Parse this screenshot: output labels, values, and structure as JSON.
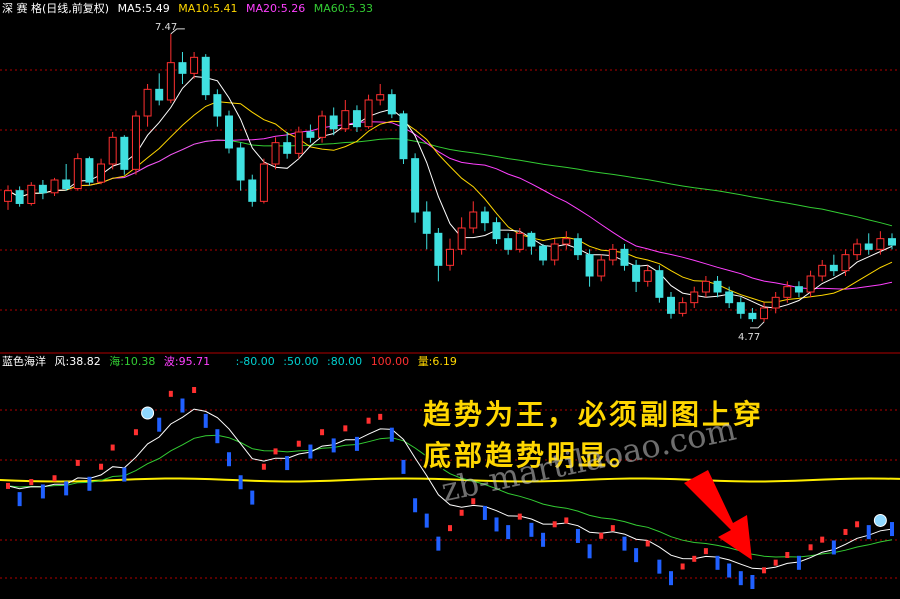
{
  "main_header": {
    "title": "深 赛 格(日线,前复权)",
    "items": [
      {
        "text": "MA5:5.49",
        "color": "#FFFFFF"
      },
      {
        "text": "MA10:5.41",
        "color": "#FFD700"
      },
      {
        "text": "MA20:5.26",
        "color": "#FF40FF"
      },
      {
        "text": "MA60:5.33",
        "color": "#33CC33"
      }
    ]
  },
  "sub_header": {
    "items": [
      {
        "text": "蓝色海洋",
        "color": "#FFFFFF"
      },
      {
        "text": "风:38.82",
        "color": "#FFFFFF"
      },
      {
        "text": "海:10.38",
        "color": "#33CC33"
      },
      {
        "text": "波:95.71",
        "color": "#FF40FF"
      },
      {
        "text": ":-80.00",
        "color": "#00D0D0"
      },
      {
        "text": ":50.00",
        "color": "#00D0D0"
      },
      {
        "text": ":80.00",
        "color": "#00D0D0"
      },
      {
        "text": "100.00",
        "color": "#FF3030"
      },
      {
        "text": "量:6.19",
        "color": "#FFD700"
      }
    ]
  },
  "peak_label": "7.47",
  "trough_label": "4.77",
  "annotation": {
    "line1": "趋势为王，必须副图上穿",
    "line2": "底部趋势明显。"
  },
  "watermark": "zb-martilaoao.com",
  "colors": {
    "up": "#FF3030",
    "down": "#40E0E0",
    "ma60": "#33CC33",
    "ma20": "#FF40FF",
    "ma10": "#FFD700",
    "ma5": "#FFFFFF",
    "dash": "#B00000",
    "arrow": "#FF0000"
  },
  "chart_data": [
    {
      "type": "candlestick",
      "title": "深 赛 格(日线,前复权)",
      "ylim": [
        4.6,
        7.6
      ],
      "annotations": [
        {
          "label": "7.47",
          "value": 7.47
        },
        {
          "label": "4.77",
          "value": 4.77
        }
      ],
      "series": [
        {
          "name": "MA5",
          "last": 5.49
        },
        {
          "name": "MA10",
          "last": 5.41
        },
        {
          "name": "MA20",
          "last": 5.26
        },
        {
          "name": "MA60",
          "last": 5.33
        }
      ],
      "candles": [
        [
          5.9,
          6.0,
          5.82,
          6.05
        ],
        [
          6.0,
          5.88,
          5.85,
          6.04
        ],
        [
          5.88,
          6.05,
          5.86,
          6.08
        ],
        [
          6.05,
          5.98,
          5.92,
          6.1
        ],
        [
          5.98,
          6.1,
          5.95,
          6.12
        ],
        [
          6.1,
          6.02,
          6.0,
          6.25
        ],
        [
          6.02,
          6.3,
          6.0,
          6.35
        ],
        [
          6.3,
          6.08,
          6.05,
          6.32
        ],
        [
          6.08,
          6.25,
          6.06,
          6.3
        ],
        [
          6.25,
          6.5,
          6.2,
          6.55
        ],
        [
          6.5,
          6.2,
          6.15,
          6.52
        ],
        [
          6.2,
          6.7,
          6.15,
          6.75
        ],
        [
          6.7,
          6.95,
          6.6,
          7.0
        ],
        [
          6.95,
          6.85,
          6.8,
          7.1
        ],
        [
          6.85,
          7.2,
          6.82,
          7.47
        ],
        [
          7.2,
          7.1,
          7.0,
          7.3
        ],
        [
          7.1,
          7.25,
          7.05,
          7.3
        ],
        [
          7.25,
          6.9,
          6.85,
          7.28
        ],
        [
          6.9,
          6.7,
          6.6,
          6.95
        ],
        [
          6.7,
          6.4,
          6.35,
          6.75
        ],
        [
          6.4,
          6.1,
          6.0,
          6.45
        ],
        [
          6.1,
          5.9,
          5.85,
          6.15
        ],
        [
          5.9,
          6.25,
          5.88,
          6.3
        ],
        [
          6.25,
          6.45,
          6.2,
          6.5
        ],
        [
          6.45,
          6.35,
          6.3,
          6.55
        ],
        [
          6.35,
          6.55,
          6.3,
          6.6
        ],
        [
          6.55,
          6.5,
          6.45,
          6.62
        ],
        [
          6.5,
          6.7,
          6.45,
          6.75
        ],
        [
          6.7,
          6.58,
          6.52,
          6.78
        ],
        [
          6.58,
          6.75,
          6.55,
          6.85
        ],
        [
          6.75,
          6.6,
          6.55,
          6.8
        ],
        [
          6.6,
          6.85,
          6.58,
          6.9
        ],
        [
          6.85,
          6.9,
          6.8,
          7.0
        ],
        [
          6.9,
          6.72,
          6.68,
          6.95
        ],
        [
          6.72,
          6.3,
          6.25,
          6.75
        ],
        [
          6.3,
          5.8,
          5.7,
          6.35
        ],
        [
          5.8,
          5.6,
          5.45,
          5.9
        ],
        [
          5.6,
          5.3,
          5.15,
          5.65
        ],
        [
          5.3,
          5.45,
          5.25,
          5.55
        ],
        [
          5.45,
          5.65,
          5.4,
          5.75
        ],
        [
          5.65,
          5.8,
          5.6,
          5.9
        ],
        [
          5.8,
          5.7,
          5.62,
          5.85
        ],
        [
          5.7,
          5.55,
          5.5,
          5.75
        ],
        [
          5.55,
          5.45,
          5.4,
          5.6
        ],
        [
          5.45,
          5.6,
          5.42,
          5.65
        ],
        [
          5.6,
          5.48,
          5.4,
          5.62
        ],
        [
          5.48,
          5.35,
          5.3,
          5.5
        ],
        [
          5.35,
          5.5,
          5.3,
          5.55
        ],
        [
          5.5,
          5.55,
          5.45,
          5.62
        ],
        [
          5.55,
          5.4,
          5.35,
          5.6
        ],
        [
          5.4,
          5.2,
          5.1,
          5.45
        ],
        [
          5.2,
          5.35,
          5.15,
          5.4
        ],
        [
          5.35,
          5.45,
          5.3,
          5.5
        ],
        [
          5.45,
          5.3,
          5.25,
          5.5
        ],
        [
          5.3,
          5.15,
          5.05,
          5.35
        ],
        [
          5.15,
          5.25,
          5.1,
          5.3
        ],
        [
          5.25,
          5.0,
          4.95,
          5.3
        ],
        [
          5.0,
          4.85,
          4.8,
          5.05
        ],
        [
          4.85,
          4.95,
          4.82,
          5.0
        ],
        [
          4.95,
          5.05,
          4.9,
          5.1
        ],
        [
          5.05,
          5.15,
          5.0,
          5.2
        ],
        [
          5.15,
          5.05,
          5.0,
          5.2
        ],
        [
          5.05,
          4.95,
          4.9,
          5.1
        ],
        [
          4.95,
          4.85,
          4.8,
          5.0
        ],
        [
          4.85,
          4.8,
          4.77,
          4.9
        ],
        [
          4.8,
          4.9,
          4.77,
          4.95
        ],
        [
          4.9,
          5.0,
          4.85,
          5.05
        ],
        [
          5.0,
          5.1,
          4.95,
          5.15
        ],
        [
          5.1,
          5.05,
          5.0,
          5.15
        ],
        [
          5.05,
          5.2,
          5.0,
          5.25
        ],
        [
          5.2,
          5.3,
          5.15,
          5.35
        ],
        [
          5.3,
          5.25,
          5.2,
          5.4
        ],
        [
          5.25,
          5.4,
          5.2,
          5.45
        ],
        [
          5.4,
          5.5,
          5.35,
          5.55
        ],
        [
          5.5,
          5.45,
          5.4,
          5.6
        ],
        [
          5.45,
          5.55,
          5.4,
          5.62
        ],
        [
          5.55,
          5.49,
          5.45,
          5.6
        ]
      ]
    },
    {
      "type": "line",
      "title": "蓝色海洋",
      "series": [
        {
          "name": "风",
          "last": 38.82
        },
        {
          "name": "海",
          "last": 10.38
        },
        {
          "name": "波",
          "last": 95.71
        },
        {
          "name": "量",
          "last": 6.19
        }
      ],
      "levels": [
        -80,
        50,
        80,
        100
      ]
    }
  ]
}
